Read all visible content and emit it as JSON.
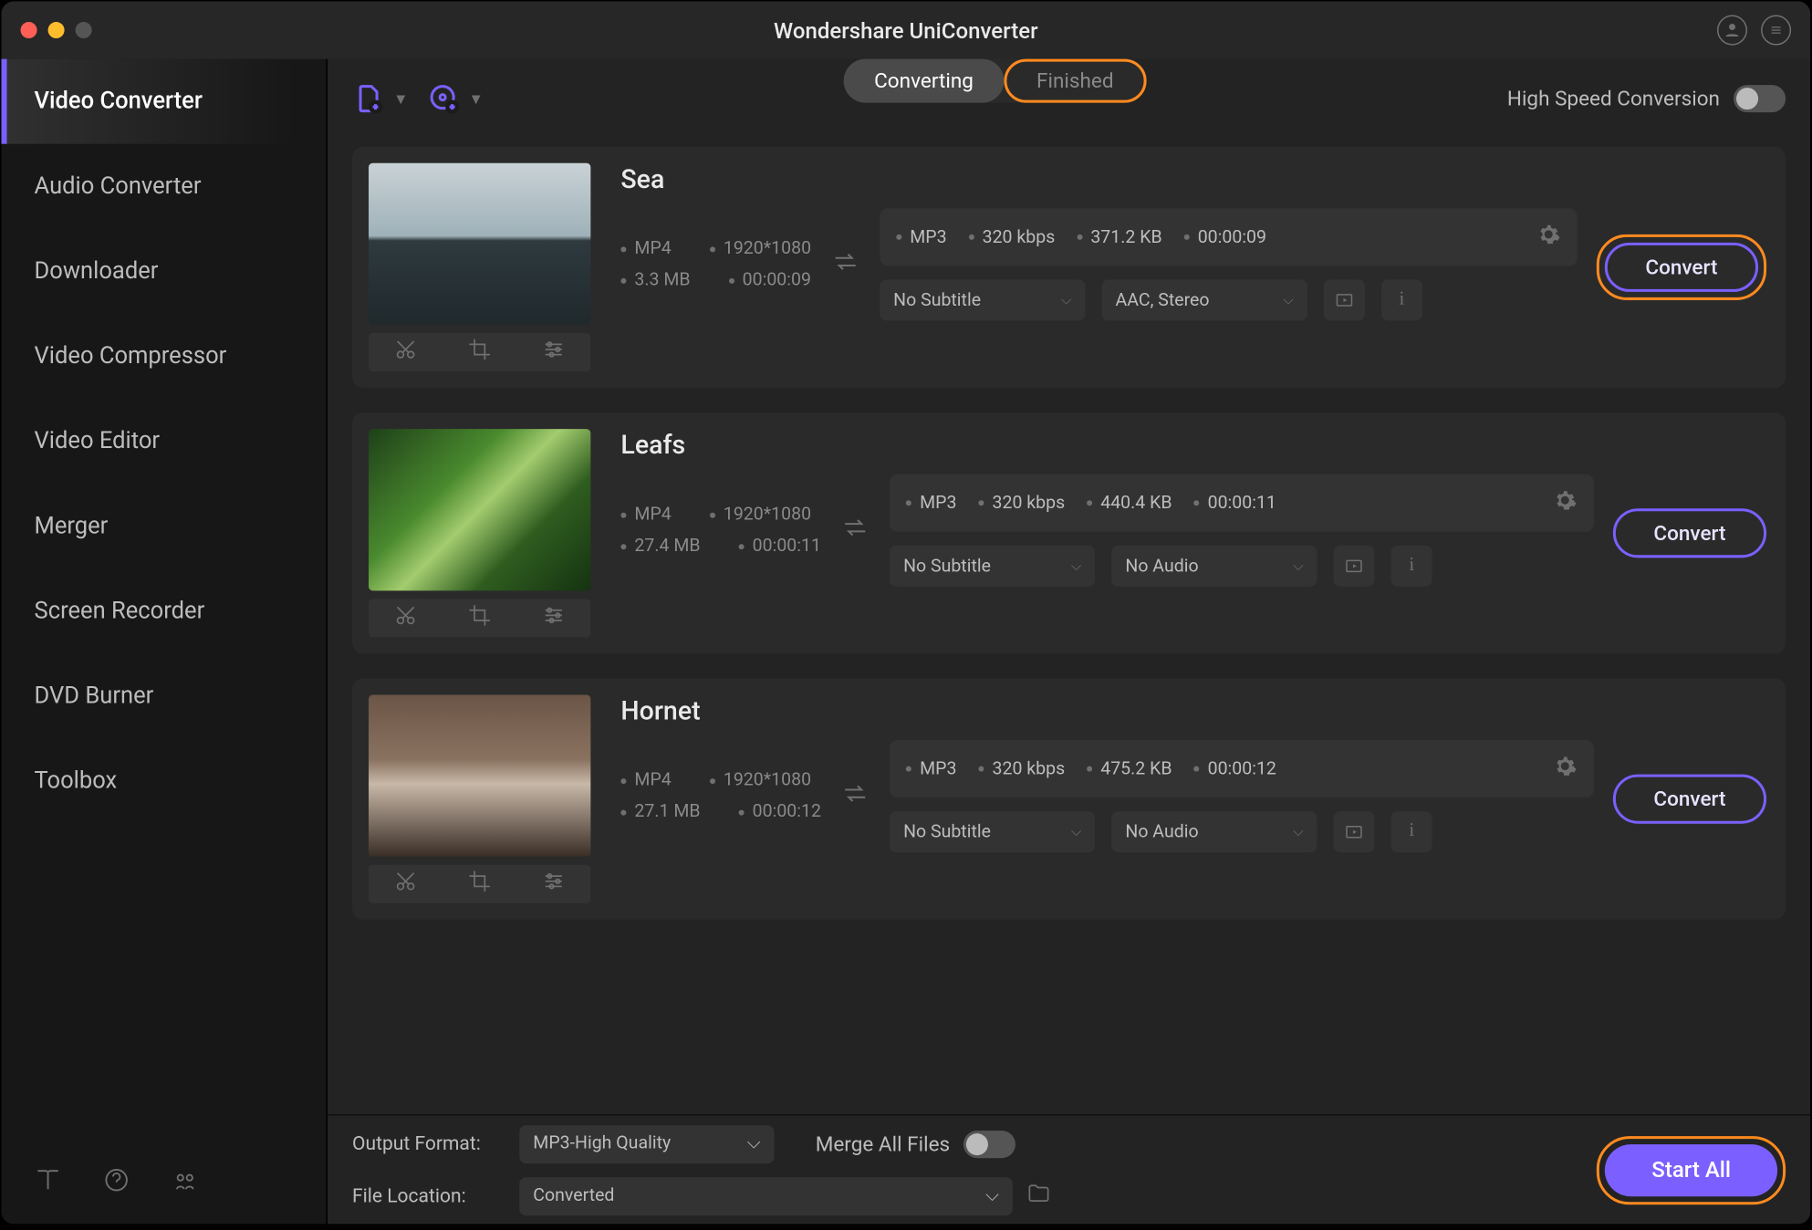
{
  "title": "Wondershare UniConverter",
  "sidebar": {
    "items": [
      "Video Converter",
      "Audio Converter",
      "Downloader",
      "Video Compressor",
      "Video Editor",
      "Merger",
      "Screen Recorder",
      "DVD Burner",
      "Toolbox"
    ],
    "activeIndex": 0
  },
  "toolbar": {
    "tabs": {
      "converting": "Converting",
      "finished": "Finished"
    },
    "highSpeed": "High Speed Conversion"
  },
  "items": [
    {
      "name": "Sea",
      "src": {
        "format": "MP4",
        "resolution": "1920*1080",
        "size": "3.3 MB",
        "duration": "00:00:09"
      },
      "out": {
        "format": "MP3",
        "bitrate": "320 kbps",
        "size": "371.2 KB",
        "duration": "00:00:09"
      },
      "subtitle": "No Subtitle",
      "audio": "AAC, Stereo",
      "convert": "Convert",
      "thumbGradient": "linear-gradient(180deg,#c9d2d6 0%,#9fb1b9 45%,#2e3a3f 48%,#20292c 100%)",
      "highlightOrange": true
    },
    {
      "name": "Leafs",
      "src": {
        "format": "MP4",
        "resolution": "1920*1080",
        "size": "27.4 MB",
        "duration": "00:00:11"
      },
      "out": {
        "format": "MP3",
        "bitrate": "320 kbps",
        "size": "440.4 KB",
        "duration": "00:00:11"
      },
      "subtitle": "No Subtitle",
      "audio": "No Audio",
      "convert": "Convert",
      "thumbGradient": "linear-gradient(135deg,#1e4019 0%,#4a8a2e 35%,#a3cc6e 50%,#2f5d1f 70%,#153211 100%)",
      "highlightOrange": false
    },
    {
      "name": "Hornet",
      "src": {
        "format": "MP4",
        "resolution": "1920*1080",
        "size": "27.1 MB",
        "duration": "00:00:12"
      },
      "out": {
        "format": "MP3",
        "bitrate": "320 kbps",
        "size": "475.2 KB",
        "duration": "00:00:12"
      },
      "subtitle": "No Subtitle",
      "audio": "No Audio",
      "convert": "Convert",
      "thumbGradient": "linear-gradient(180deg,#6b5546 0%,#8a7260 40%,#c8b8a8 55%,#3a2e26 100%)",
      "highlightOrange": false
    }
  ],
  "bottom": {
    "outputFormatLabel": "Output Format:",
    "outputFormatValue": "MP3-High Quality",
    "fileLocationLabel": "File Location:",
    "fileLocationValue": "Converted",
    "mergeLabel": "Merge All Files",
    "startAll": "Start All"
  }
}
